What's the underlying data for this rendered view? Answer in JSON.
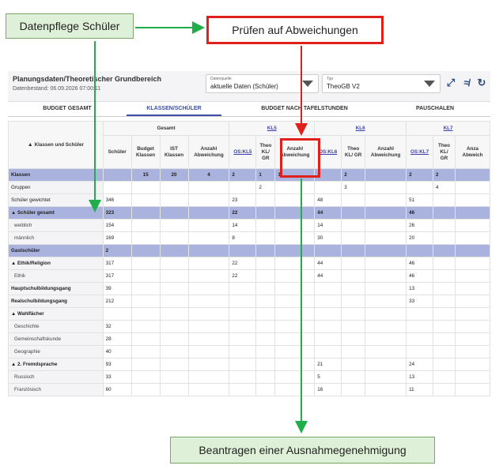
{
  "callouts": {
    "datenpflege": "Datenpflege Schüler",
    "pruefen": "Prüfen auf Abweichungen",
    "beantragen": "Beantragen einer Ausnahmegenehmigung"
  },
  "header": {
    "title": "Planungsdaten/Theoretischer Grundbereich",
    "subtitle": "Datenbestand: 06.09.2026 07:00:11",
    "source_label": "Datenquelle",
    "source_value": "aktuelle Daten (Schüler)",
    "type_label": "Typ",
    "type_value": "TheoGB V2"
  },
  "tabs": [
    "BUDGET GESAMT",
    "KLASSEN/SCHÜLER",
    "BUDGET NACH TAFELSTUNDEN",
    "PAUSCHALEN"
  ],
  "table": {
    "row_header": "Klassen und Schüler",
    "groups": {
      "gesamt": "Gesamt",
      "kl5": "KL5",
      "kl6": "KL6",
      "kl7": "KL7"
    },
    "cols": {
      "schueler": "Schüler",
      "budget": "Budget Klassen",
      "ist": "IST Klassen",
      "anzahl": "Anzahl Abweichung",
      "os5": "OS:KL5",
      "theo": "Theo KL/ GR",
      "anzahl5": "Anzahl Abweichung",
      "os6": "OS:KL6",
      "anzahl6": "Anzahl Abweichung",
      "os7": "OS:KL7",
      "anzahl7": "Anza Abweich"
    },
    "rows": [
      {
        "label": "Klassen",
        "hl": true,
        "v": [
          "",
          "15",
          "20",
          "4",
          "2",
          "1",
          "1",
          "2",
          "2",
          "",
          "2",
          "2",
          ""
        ]
      },
      {
        "label": "Gruppen",
        "v": [
          "",
          "",
          "",
          "",
          "",
          "2",
          "",
          "",
          "3",
          "",
          "",
          "4",
          ""
        ]
      },
      {
        "label": "Schüler gewichtet",
        "v": [
          "346",
          "",
          "",
          "",
          "23",
          "",
          "",
          "48",
          "",
          "",
          "51",
          "",
          ""
        ]
      },
      {
        "label": "Schüler gesamt",
        "hl": true,
        "tri": true,
        "v": [
          "323",
          "",
          "",
          "",
          "22",
          "",
          "",
          "44",
          "",
          "",
          "46",
          "",
          ""
        ]
      },
      {
        "label": "weiblich",
        "sub": true,
        "v": [
          "154",
          "",
          "",
          "",
          "14",
          "",
          "",
          "14",
          "",
          "",
          "26",
          "",
          ""
        ]
      },
      {
        "label": "männlich",
        "sub": true,
        "v": [
          "169",
          "",
          "",
          "",
          "8",
          "",
          "",
          "30",
          "",
          "",
          "20",
          "",
          ""
        ]
      },
      {
        "label": "Gastschüler",
        "hl": true,
        "v": [
          "2",
          "",
          "",
          "",
          "",
          "",
          "",
          "",
          "",
          "",
          "",
          "",
          ""
        ]
      },
      {
        "label": "Ethik/Religion",
        "tri": true,
        "b": true,
        "v": [
          "317",
          "",
          "",
          "",
          "22",
          "",
          "",
          "44",
          "",
          "",
          "46",
          "",
          ""
        ]
      },
      {
        "label": "Ethik",
        "sub": true,
        "v": [
          "317",
          "",
          "",
          "",
          "22",
          "",
          "",
          "44",
          "",
          "",
          "46",
          "",
          ""
        ]
      },
      {
        "label": "Hauptschulbildungsgang",
        "b": true,
        "v": [
          "39",
          "",
          "",
          "",
          "",
          "",
          "",
          "",
          "",
          "",
          "13",
          "",
          ""
        ]
      },
      {
        "label": "Realschulbildungsgang",
        "b": true,
        "v": [
          "212",
          "",
          "",
          "",
          "",
          "",
          "",
          "",
          "",
          "",
          "33",
          "",
          ""
        ]
      },
      {
        "label": "Wahlfächer",
        "tri": true,
        "b": true,
        "v": [
          "",
          "",
          "",
          "",
          "",
          "",
          "",
          "",
          "",
          "",
          "",
          "",
          ""
        ]
      },
      {
        "label": "Geschichte",
        "sub": true,
        "v": [
          "32",
          "",
          "",
          "",
          "",
          "",
          "",
          "",
          "",
          "",
          "",
          "",
          ""
        ]
      },
      {
        "label": "Gemeinschaftskunde",
        "sub": true,
        "v": [
          "28",
          "",
          "",
          "",
          "",
          "",
          "",
          "",
          "",
          "",
          "",
          "",
          ""
        ]
      },
      {
        "label": "Geographie",
        "sub": true,
        "v": [
          "40",
          "",
          "",
          "",
          "",
          "",
          "",
          "",
          "",
          "",
          "",
          "",
          ""
        ]
      },
      {
        "label": "2. Fremdsprache",
        "tri": true,
        "b": true,
        "v": [
          "93",
          "",
          "",
          "",
          "",
          "",
          "",
          "21",
          "",
          "",
          "24",
          "",
          ""
        ]
      },
      {
        "label": "Russisch",
        "sub": true,
        "v": [
          "33",
          "",
          "",
          "",
          "",
          "",
          "",
          "5",
          "",
          "",
          "13",
          "",
          ""
        ]
      },
      {
        "label": "Französisch",
        "sub": true,
        "v": [
          "60",
          "",
          "",
          "",
          "",
          "",
          "",
          "16",
          "",
          "",
          "11",
          "",
          ""
        ]
      }
    ]
  },
  "colors": {
    "highlight": "#aab3de",
    "red": "#e0201b",
    "green_arrow": "#1fae4b",
    "callout_green": "#dff0d8"
  }
}
